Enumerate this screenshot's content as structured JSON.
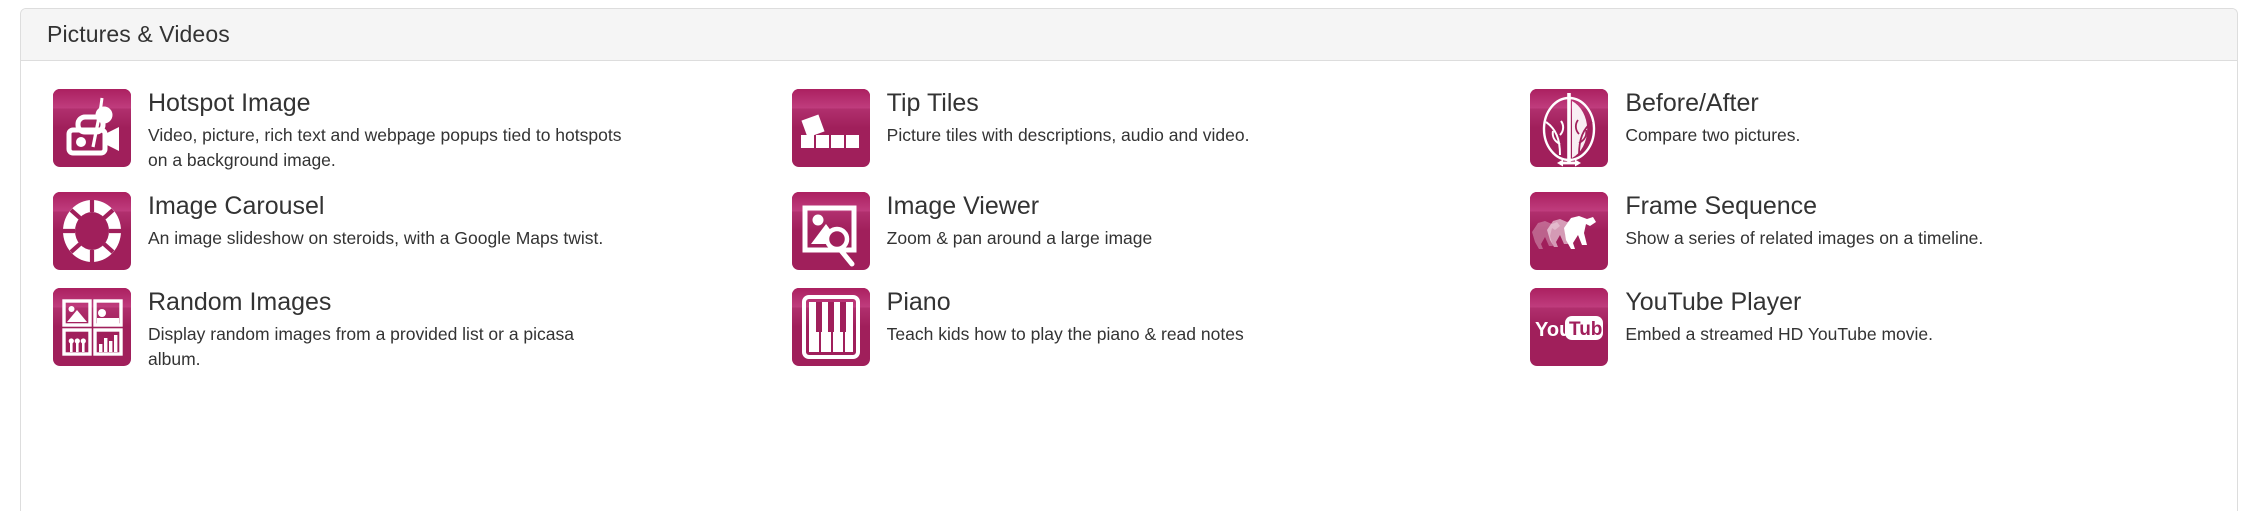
{
  "panel": {
    "title": "Pictures & Videos"
  },
  "theme": {
    "accent": "#a01f5b",
    "accent_light": "#bf3c7d",
    "panel_header_bg": "#f5f5f5",
    "border": "#dddddd",
    "text": "#333333"
  },
  "widgets": [
    {
      "icon": "hotspot-image-icon",
      "title": "Hotspot Image",
      "description": "Video, picture, rich text and webpage popups tied to hotspots on a background image."
    },
    {
      "icon": "tip-tiles-icon",
      "title": "Tip Tiles",
      "description": "Picture tiles with descriptions, audio and video."
    },
    {
      "icon": "before-after-icon",
      "title": "Before/After",
      "description": "Compare two pictures."
    },
    {
      "icon": "image-carousel-icon",
      "title": "Image Carousel",
      "description": "An image slideshow on steroids, with a Google Maps twist."
    },
    {
      "icon": "image-viewer-icon",
      "title": "Image Viewer",
      "description": "Zoom & pan around a large image"
    },
    {
      "icon": "frame-sequence-icon",
      "title": "Frame Sequence",
      "description": "Show a series of related images on a timeline."
    },
    {
      "icon": "random-images-icon",
      "title": "Random Images",
      "description": "Display random images from a provided list or a picasa album."
    },
    {
      "icon": "piano-icon",
      "title": "Piano",
      "description": "Teach kids how to play the piano & read notes"
    },
    {
      "icon": "youtube-player-icon",
      "title": "YouTube Player",
      "description": "Embed a streamed HD YouTube movie.",
      "logo_text_1": "You",
      "logo_text_2": "Tube"
    }
  ]
}
